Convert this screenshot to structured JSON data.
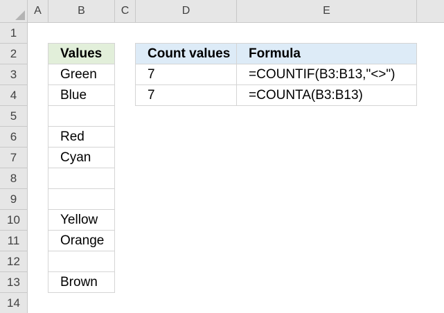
{
  "spreadsheet": {
    "columns": [
      "A",
      "B",
      "C",
      "D",
      "E"
    ],
    "rows": [
      "1",
      "2",
      "3",
      "4",
      "5",
      "6",
      "7",
      "8",
      "9",
      "10",
      "11",
      "12",
      "13",
      "14"
    ],
    "values_table": {
      "header": "Values",
      "items": [
        "Green",
        "Blue",
        "",
        "Red",
        "Cyan",
        "",
        "",
        "Yellow",
        "Orange",
        "",
        "Brown"
      ]
    },
    "count_table": {
      "headers": [
        "Count values",
        "Formula"
      ],
      "rows": [
        {
          "count": "7",
          "formula": "=COUNTIF(B3:B13,\"<>\")"
        },
        {
          "count": "7",
          "formula": "=COUNTA(B3:B13)"
        }
      ]
    }
  },
  "colors": {
    "header_bg": "#e6e6e6",
    "values_header_bg": "#e2efda",
    "count_header_bg": "#ddebf7",
    "cell_border": "#d4d4d4"
  }
}
